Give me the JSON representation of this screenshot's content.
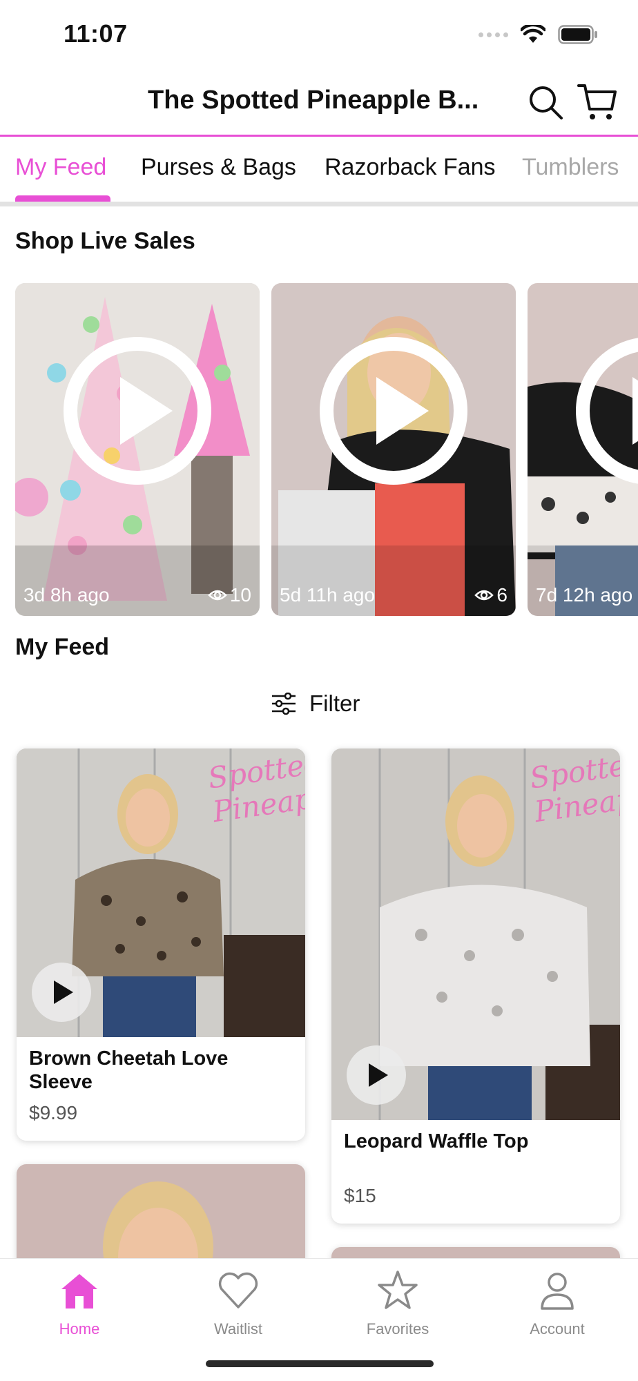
{
  "status_bar": {
    "time": "11:07"
  },
  "header": {
    "title": "The Spotted Pineapple B..."
  },
  "tabs": [
    {
      "label": "My Feed",
      "active": true
    },
    {
      "label": "Purses & Bags"
    },
    {
      "label": "Razorback Fans"
    },
    {
      "label": "Tumblers"
    }
  ],
  "live_sales": {
    "heading": "Shop Live Sales",
    "items": [
      {
        "time_ago": "3d 8h ago",
        "views": "10"
      },
      {
        "time_ago": "5d 11h ago",
        "views": "6"
      },
      {
        "time_ago": "7d 12h ago",
        "views": ""
      }
    ]
  },
  "feed": {
    "heading": "My Feed",
    "filter_label": "Filter",
    "products": [
      {
        "name": "Brown Cheetah Love Sleeve",
        "price": "$9.99",
        "watermark": "Spotted Pineapple"
      },
      {
        "name": "Leopard Waffle Top",
        "price": "$15",
        "watermark": "Spotted Pineapple"
      }
    ]
  },
  "bottom_nav": {
    "items": [
      {
        "label": "Home",
        "active": true
      },
      {
        "label": "Waitlist"
      },
      {
        "label": "Favorites"
      },
      {
        "label": "Account"
      }
    ]
  },
  "colors": {
    "accent": "#e84fd5",
    "text": "#111111",
    "muted": "#8a8a8a"
  },
  "icons": [
    "search-icon",
    "cart-icon",
    "play-icon",
    "eye-icon",
    "filter-icon",
    "home-icon",
    "heart-icon",
    "star-icon",
    "user-icon"
  ]
}
